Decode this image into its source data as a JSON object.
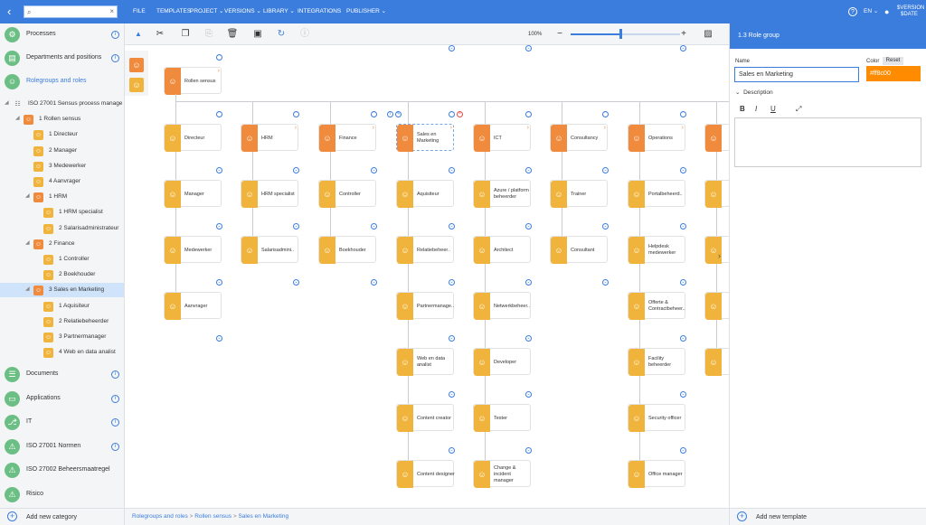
{
  "topbar": {
    "menus": [
      "FILE",
      "TEMPLATES",
      "PROJECT",
      "VERSIONS",
      "LIBRARY",
      "INTEGRATIONS",
      "PUBLISHER"
    ],
    "language": "EN",
    "version_line1": "$VERSION",
    "version_line2": "$DATE",
    "search_value": ""
  },
  "sidebar": {
    "categories_top": [
      {
        "label": "Processes",
        "icon": "process-icon"
      },
      {
        "label": "Departments and positions",
        "icon": "department-icon"
      },
      {
        "label": "Rolegroups and roles",
        "icon": "rolegroup-icon"
      }
    ],
    "tree": [
      {
        "label": "ISO 27001 Sensus process manage",
        "level": 0,
        "kind": "root"
      },
      {
        "label": "1 Rollen sensus",
        "level": 1,
        "kind": "group"
      },
      {
        "label": "1 Directeur",
        "level": 2,
        "kind": "role"
      },
      {
        "label": "2 Manager",
        "level": 2,
        "kind": "role"
      },
      {
        "label": "3 Medewerker",
        "level": 2,
        "kind": "role"
      },
      {
        "label": "4 Aanvrager",
        "level": 2,
        "kind": "role"
      },
      {
        "label": "1 HRM",
        "level": 2,
        "kind": "group"
      },
      {
        "label": "1 HRM specialist",
        "level": 3,
        "kind": "role"
      },
      {
        "label": "2 Salarisadministrateur",
        "level": 3,
        "kind": "role"
      },
      {
        "label": "2 Finance",
        "level": 2,
        "kind": "group"
      },
      {
        "label": "1 Controller",
        "level": 3,
        "kind": "role"
      },
      {
        "label": "2 Boekhouder",
        "level": 3,
        "kind": "role"
      },
      {
        "label": "3 Sales en Marketing",
        "level": 2,
        "kind": "group",
        "selected": true
      },
      {
        "label": "1 Aquisiteur",
        "level": 3,
        "kind": "role"
      },
      {
        "label": "2 Relatiebeheerder",
        "level": 3,
        "kind": "role"
      },
      {
        "label": "3 Partnermanager",
        "level": 3,
        "kind": "role"
      },
      {
        "label": "4 Web en data analist",
        "level": 3,
        "kind": "role"
      }
    ],
    "categories_bottom": [
      {
        "label": "Documents",
        "icon": "document-icon",
        "info": true
      },
      {
        "label": "Applications",
        "icon": "application-icon",
        "info": true
      },
      {
        "label": "IT",
        "icon": "it-icon",
        "info": true
      },
      {
        "label": "ISO 27001 Normen",
        "icon": "warning-icon",
        "info": true
      },
      {
        "label": "ISO 27002 Beheersmaatregel",
        "icon": "warning-icon",
        "info": false
      },
      {
        "label": "Risico",
        "icon": "warning-icon",
        "info": false
      }
    ],
    "add_category": "Add new category"
  },
  "toolbar": {
    "zoom": "100%",
    "zoom_fraction": 0.45
  },
  "canvas": {
    "root": {
      "label": "Rollen sensus"
    },
    "columns": [
      {
        "label": "Directeur",
        "group": false,
        "children": [
          "Manager",
          "Medewerker",
          "Aanvrager"
        ]
      },
      {
        "label": "HRM",
        "group": true,
        "children": [
          "HRM specialist",
          "Salarisadmini.."
        ]
      },
      {
        "label": "Finance",
        "group": true,
        "children": [
          "Controller",
          "Boekhouder"
        ]
      },
      {
        "label": "Sales en Marketing",
        "group": true,
        "selected": true,
        "children": [
          "Aquisiteur",
          "Relatiebeheer..",
          "Partnermanage..",
          "Web en data analist",
          "Content creator",
          "Content designer"
        ]
      },
      {
        "label": "ICT",
        "group": true,
        "children": [
          "Azure / platform beheerder",
          "Architect",
          "Netwerkbeheer..",
          "Developer",
          "Tester",
          "Change & incident manager"
        ]
      },
      {
        "label": "Consultancy",
        "group": true,
        "children": [
          "Trainer",
          "Consultant"
        ]
      },
      {
        "label": "Operations",
        "group": true,
        "children": [
          "Portalbeheerd..",
          "Helpdesk medewerker",
          "Offerte & Contractbeheer..",
          "Facility beheerder",
          "Security officer",
          "Office manager"
        ]
      },
      {
        "label": "",
        "group": true,
        "children": [
          "",
          "",
          "",
          ""
        ]
      }
    ]
  },
  "breadcrumb": [
    "Rolegroups and roles",
    "Rollen sensus",
    "Sales en Marketing"
  ],
  "panel": {
    "title": "1.3 Role group",
    "name_label": "Name",
    "name_value": "Sales en Marketing",
    "color_label": "Color",
    "reset_label": "Reset",
    "color_value": "#ff8c00",
    "description_label": "Description",
    "format_buttons": [
      "B",
      "I",
      "U"
    ],
    "add_template": "Add new template"
  }
}
